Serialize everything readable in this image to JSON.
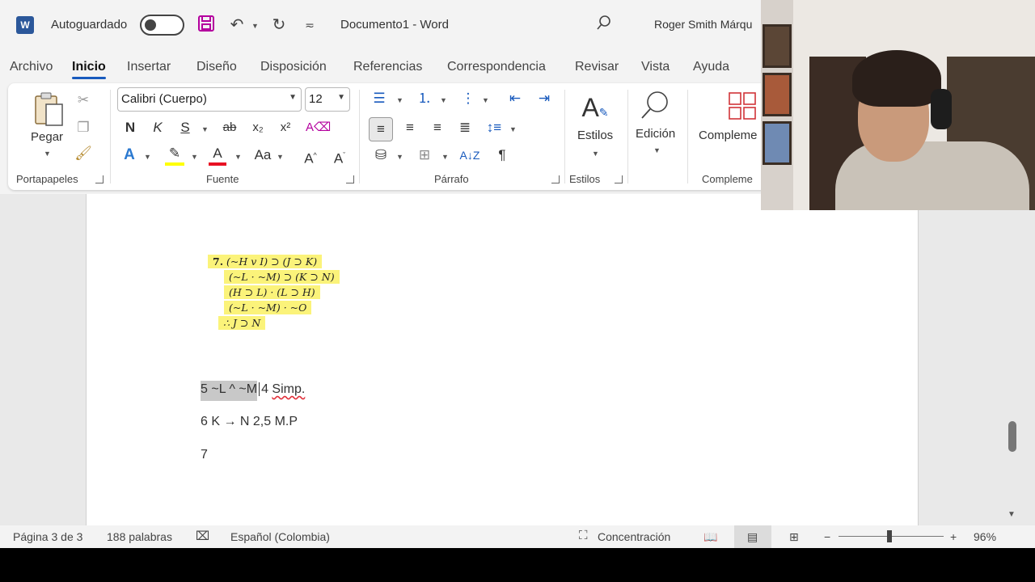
{
  "titlebar": {
    "autosave_label": "Autoguardado",
    "doc_title": "Documento1  -  Word",
    "user_name": "Roger Smith Márqu"
  },
  "menu": {
    "tabs": [
      "Archivo",
      "Inicio",
      "Insertar",
      "Diseño",
      "Disposición",
      "Referencias",
      "Correspondencia",
      "Revisar",
      "Vista",
      "Ayuda"
    ],
    "active": "Inicio"
  },
  "ribbon": {
    "paste_label": "Pegar",
    "font_name": "Calibri (Cuerpo)",
    "font_size": "12",
    "bold_glyph": "N",
    "italic_glyph": "K",
    "underline_glyph": "S",
    "strike_glyph": "ab",
    "styles_label": "Estilos",
    "editing_label": "Edición",
    "addins_label": "Compleme",
    "groups": {
      "clipboard": "Portapapeles",
      "font": "Fuente",
      "paragraph": "Párrafo",
      "styles": "Estilos",
      "addins": "Compleme"
    }
  },
  "document": {
    "problem": {
      "number": "7.",
      "lines": [
        "(~H v I) ⊃ (J ⊃ K)",
        "(~L · ~M) ⊃ (K ⊃ N)",
        "(H ⊃ L) · (L ⊃ H)",
        "(~L · ~M) · ~O",
        "∴ J ⊃ N"
      ]
    },
    "line5_selected": "5 ~L ^ ~M",
    "line5_rest": "4 ",
    "line5_rule": "Simp.",
    "line6": "6 K → N 2,5 M.P",
    "line7": "7"
  },
  "status": {
    "page": "Página 3 de 3",
    "words": "188 palabras",
    "language": "Español (Colombia)",
    "focus": "Concentración",
    "zoom": "96%"
  },
  "colors": {
    "accent": "#185abd",
    "highlight": "#fbf37a",
    "word_blue": "#2b579a"
  }
}
